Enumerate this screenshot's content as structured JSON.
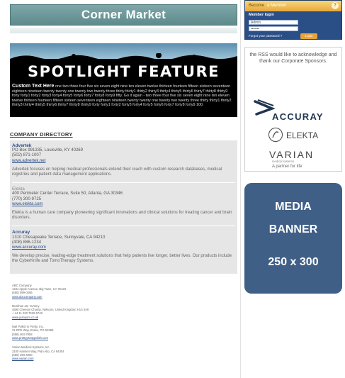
{
  "header": {
    "title": "Corner Market"
  },
  "spotlight": {
    "title": "SPOTLIGHT FEATURE",
    "custom_label": "Custom Text Here",
    "custom_text": " one two three four five six seven eight nine ten eleven twelve thirteen fourteen fifteen sixteen seventeen eighteen nineteen twenty twenty one twenty two twenty three thirty thirty1 thirty2 thirty3 thirty4 thirty5 thirty6 thirty7 thirty8 thirty9 forty forty1 forty2 forty3 forty4 forty5 forty6 forty7 forty8 forty9 fifty. Go it again - two three four five six seven eight nine ten eleven twelve thirteen fourteen fifteen sixteen seventeen eighteen nineteen twenty twenty one twenty two twenty three thirty thirty1 thirty2 thirty3 thirty4 thirty5 thirty6 thirty7 thirty8 thirty9 forty forty1 forty2 forty3 forty4 forty5 forty6 forty7 forty8 forty9 100."
  },
  "directory": {
    "title": "COMPANY DIRECTORY",
    "featured": [
      {
        "name": "Advertek",
        "address": "PO Box 991335, Louisville, KY 40269",
        "phone": "(502) 871-1007",
        "url": "www.advertek.net",
        "desc": "Advertek focuses on helping medical professionals extend their reach with custom research databases, medical registries and patient data management applications."
      },
      {
        "name": "Elekta",
        "address": "400 Perimeter Center Terrace, Suite 50, Atlanta, GA 30346",
        "phone": "(770) 300-9725",
        "url": "www.elekta.com",
        "desc": "Elekta is a human care company pioneering significant innovations and clinical solutions for treating cancer and brain disorders."
      },
      {
        "name": "Accuray",
        "address": "1310 Chesapeake Terrace, Sunnyvale, CA 94210",
        "phone": "(408) 886-1234",
        "url": "www.accuray.com",
        "desc": "We develop precise, leading-edge treatment solutions that help patients live longer, better lives. Our products include the CyberKnife and TomoTherapy Systems."
      }
    ],
    "basic": [
      {
        "name": "ABC Company",
        "address": "1234 Apple Avenue, Big Town, CA 75123",
        "phone": "(650) 099-0456",
        "url": "www.abccompany.com"
      },
      {
        "name": "Mumhan are Yummy",
        "address": "4590 Cheetos Champ, Nelsoon, United Kingdom H1A 3A6",
        "phone": "+ 44 11 220 7528 6748",
        "url": "www.yumyum.co.uk"
      },
      {
        "name": "Nail Polish is Pretty, Inc.",
        "address": "21 DPE Way, Essex, PG 52369",
        "phone": "(656) 464-7858",
        "url": "www.prettyprettypolish.com"
      },
      {
        "name": "Varian Medical Systems, Inc.",
        "address": "3100 Hansen Way, Palo Alto, CA 94304",
        "phone": "(650) 493-4000",
        "url": "www.varian.com"
      }
    ]
  },
  "login": {
    "become": "Become",
    "member_text": "a Member",
    "help_glyph": "?",
    "heading": "Member login",
    "username_value": "Admin",
    "password_value": "•••••••",
    "forgot": "Forgot your password ?",
    "login_button": "Login"
  },
  "sponsors": {
    "message": "the RSS would like to acknowledge and thank our Corporate Sponsors.",
    "accuray": "ACCURAY",
    "elekta": "ELEKTA",
    "varian": "VARIAN",
    "varian_sub": "medical systems",
    "varian_tag": "A partner for life"
  },
  "media_banner": {
    "line1": "MEDIA",
    "line2": "BANNER",
    "line3": "250 x 300"
  },
  "colors": {
    "masthead": "#6f9799",
    "login_bg": "#2a4e86",
    "login_top": "#e9a73d",
    "media_bg": "#3f5f87",
    "link": "#2b4f8a"
  }
}
